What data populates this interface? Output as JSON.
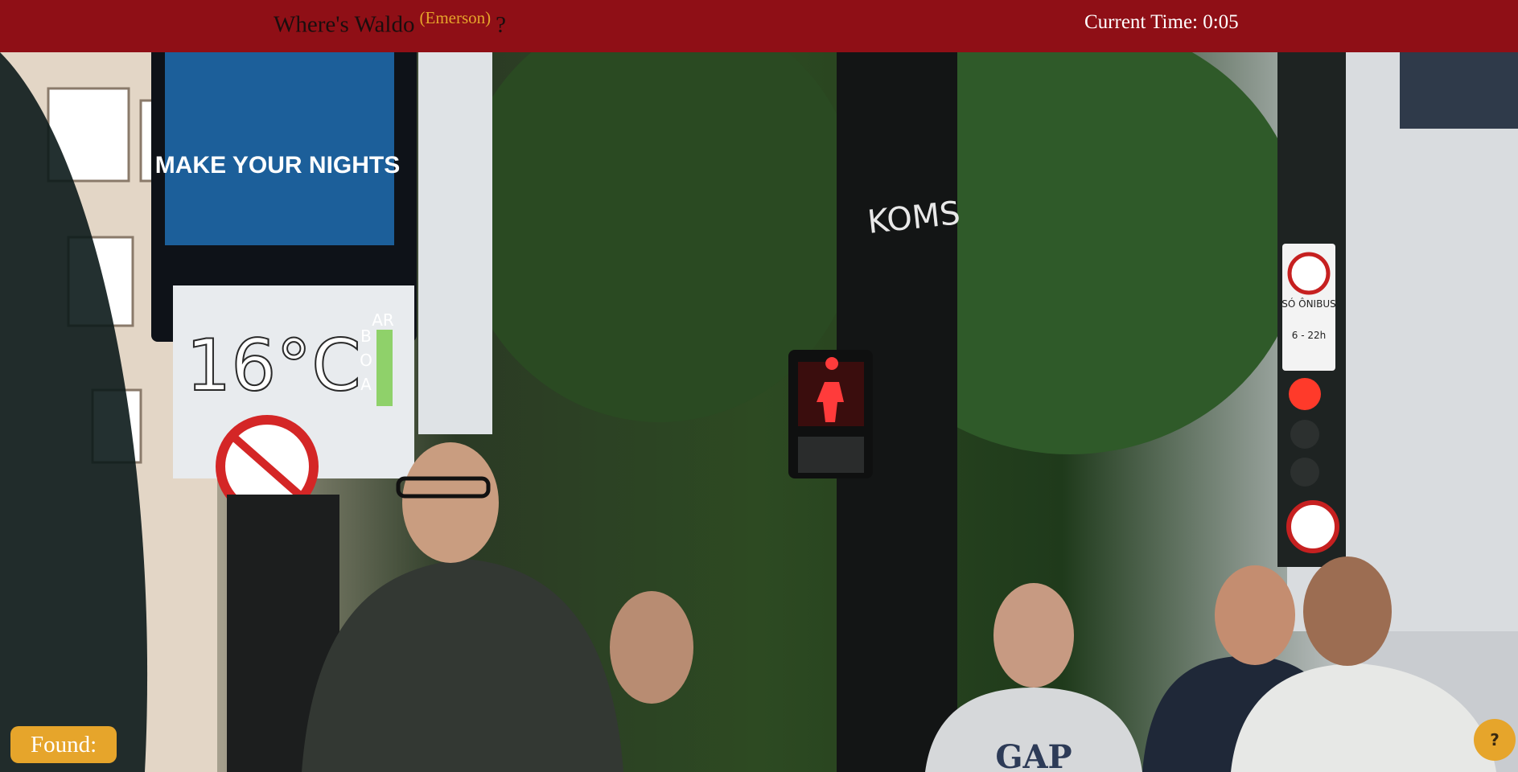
{
  "header": {
    "title": "Where's Waldo",
    "player_name": "(Emerson)",
    "question_mark": "?",
    "current_time": "Current Time: 0:05"
  },
  "scene": {
    "billboard_text": "MAKE YOUR NIGHTS",
    "temperature_display": "16°C",
    "temperature_side_letters": [
      "AR",
      "B",
      "O",
      "A"
    ],
    "graffiti_text": "KOMS",
    "bus_sign_text": "SÓ ÔNIBUS",
    "bus_sign_hours": "6 - 22h",
    "hoodie_text": "GAP"
  },
  "footer": {
    "found_label": "Found:",
    "help_label": "?"
  },
  "colors": {
    "header_bg": "#8f0f16",
    "accent": "#e6a52b"
  }
}
